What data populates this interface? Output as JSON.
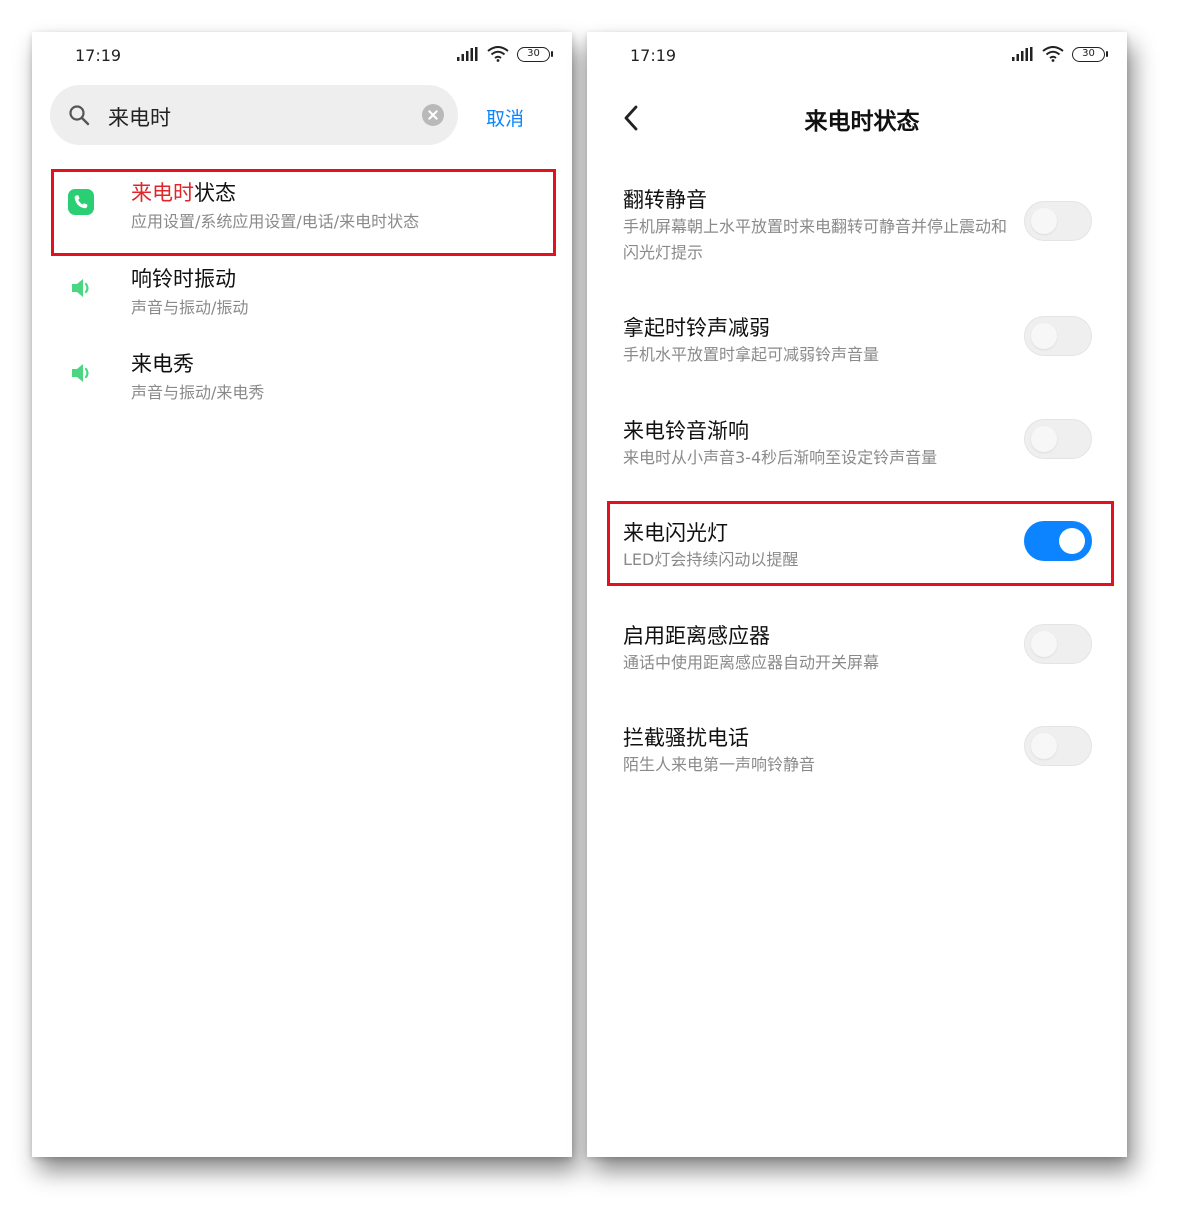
{
  "left": {
    "status": {
      "time": "17:19",
      "battery": "30"
    },
    "search": {
      "query": "来电时",
      "cancel_label": "取消"
    },
    "results": [
      {
        "title_highlight": "来电时",
        "title_rest": "状态",
        "subtitle": "应用设置/系统应用设置/电话/来电时状态",
        "icon": "phone-icon",
        "icon_color": "#2bcf73"
      },
      {
        "title_highlight": "",
        "title_rest": "响铃时振动",
        "subtitle": "声音与振动/振动",
        "icon": "speaker-icon",
        "icon_color": "#4cd681"
      },
      {
        "title_highlight": "",
        "title_rest": "来电秀",
        "subtitle": "声音与振动/来电秀",
        "icon": "speaker-icon",
        "icon_color": "#4cd681"
      }
    ]
  },
  "right": {
    "status": {
      "time": "17:19",
      "battery": "30"
    },
    "page_title": "来电时状态",
    "settings": [
      {
        "title": "翻转静音",
        "desc": "手机屏幕朝上水平放置时来电翻转可静音并停止震动和闪光灯提示",
        "enabled": false
      },
      {
        "title": "拿起时铃声减弱",
        "desc": "手机水平放置时拿起可减弱铃声音量",
        "enabled": false
      },
      {
        "title": "来电铃音渐响",
        "desc": "来电时从小声音3-4秒后渐响至设定铃声音量",
        "enabled": false
      },
      {
        "title": "来电闪光灯",
        "desc": "LED灯会持续闪动以提醒",
        "enabled": true
      },
      {
        "title": "启用距离感应器",
        "desc": "通话中使用距离感应器自动开关屏幕",
        "enabled": false
      },
      {
        "title": "拦截骚扰电话",
        "desc": "陌生人来电第一声响铃静音",
        "enabled": false
      }
    ]
  },
  "colors": {
    "accent_blue": "#0d84ff",
    "highlight_red": "#e0262a",
    "annotation_red": "#e3111f"
  }
}
